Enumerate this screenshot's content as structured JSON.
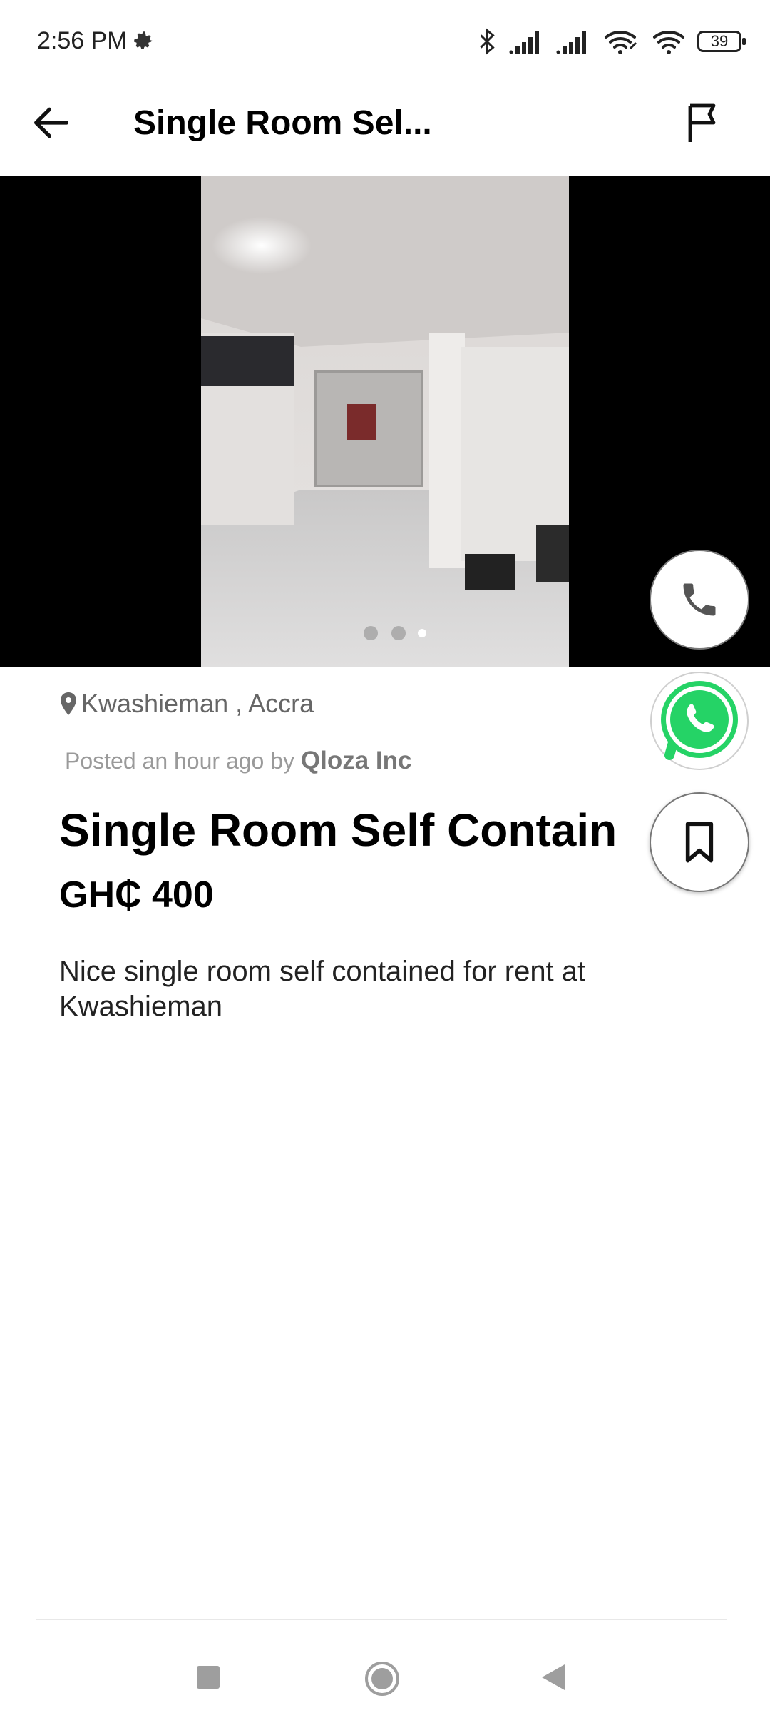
{
  "status_bar": {
    "time": "2:56 PM",
    "battery": "39",
    "icons": [
      "gear-icon",
      "bluetooth-icon",
      "signal-icon",
      "signal-icon",
      "wifi-link-icon",
      "wifi-icon",
      "battery-icon"
    ]
  },
  "app_bar": {
    "title": "Single Room Sel...",
    "back_icon": "arrow-left-icon",
    "flag_icon": "flag-icon"
  },
  "carousel": {
    "image_count": 3,
    "active_index": 2
  },
  "listing": {
    "location": "Kwashieman , Accra",
    "posted_prefix": "Posted an hour ago by",
    "poster": "Qloza Inc",
    "title": "Single Room Self Contain",
    "price": "GH₵ 400",
    "description": "Nice single room self contained for rent at Kwashieman"
  },
  "actions": {
    "call_icon": "phone-icon",
    "whatsapp_icon": "whatsapp-icon",
    "save_icon": "bookmark-icon"
  },
  "colors": {
    "whatsapp_green": "#25D366",
    "text_primary": "#000000",
    "text_secondary": "#666666"
  },
  "nav": {
    "icons": [
      "recent-apps-icon",
      "home-icon",
      "back-triangle-icon"
    ]
  }
}
